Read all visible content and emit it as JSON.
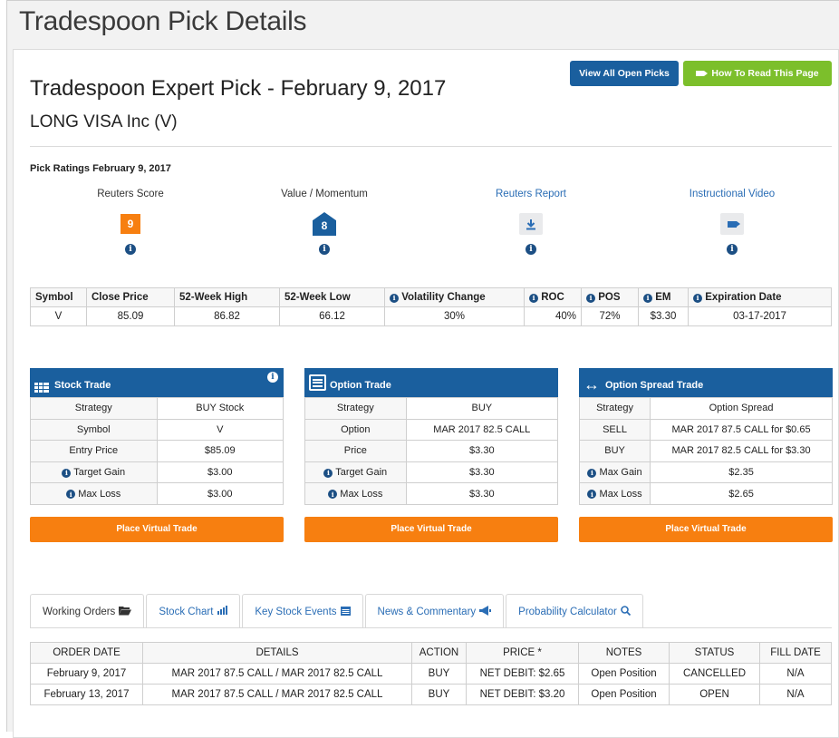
{
  "page_heading": "Tradespoon Pick Details",
  "buttons": {
    "view_all": "View All Open Picks",
    "how_to_read": "How To Read This Page"
  },
  "pick_title": "Tradespoon Expert Pick - February 9, 2017",
  "pick_subtitle": "LONG VISA Inc (V)",
  "ratings": {
    "title": "Pick Ratings February 9, 2017",
    "items": [
      {
        "label": "Reuters Score",
        "value": "9",
        "icon": "score-badge"
      },
      {
        "label": "Value / Momentum",
        "value": "8",
        "icon": "house-badge"
      },
      {
        "label": "Reuters Report",
        "value": "",
        "icon": "download-icon"
      },
      {
        "label": "Instructional Video",
        "value": "",
        "icon": "video-icon"
      }
    ]
  },
  "summary": {
    "headers": [
      "Symbol",
      "Close Price",
      "52-Week High",
      "52-Week Low",
      "Volatility Change",
      "ROC",
      "POS",
      "EM",
      "Expiration Date"
    ],
    "row": [
      "V",
      "85.09",
      "86.82",
      "66.12",
      "30%",
      "40%",
      "72%",
      "$3.30",
      "03-17-2017"
    ]
  },
  "cards": [
    {
      "title": "Stock Trade",
      "rows": [
        [
          "Strategy",
          "BUY Stock"
        ],
        [
          "Symbol",
          "V"
        ],
        [
          "Entry Price",
          "$85.09"
        ],
        [
          "Target Gain",
          "$3.00"
        ],
        [
          "Max Loss",
          "$3.00"
        ]
      ],
      "button": "Place Virtual Trade"
    },
    {
      "title": "Option Trade",
      "rows": [
        [
          "Strategy",
          "BUY"
        ],
        [
          "Option",
          "MAR 2017 82.5 CALL"
        ],
        [
          "Price",
          "$3.30"
        ],
        [
          "Target Gain",
          "$3.30"
        ],
        [
          "Max Loss",
          "$3.30"
        ]
      ],
      "button": "Place Virtual Trade"
    },
    {
      "title": "Option Spread Trade",
      "rows": [
        [
          "Strategy",
          "Option Spread"
        ],
        [
          "SELL",
          "MAR 2017 87.5 CALL for $0.65"
        ],
        [
          "BUY",
          "MAR 2017 82.5 CALL for $3.30"
        ],
        [
          "Max Gain",
          "$2.35"
        ],
        [
          "Max Loss",
          "$2.65"
        ]
      ],
      "button": "Place Virtual Trade"
    }
  ],
  "tabs": [
    "Working Orders",
    "Stock Chart",
    "Key Stock Events",
    "News & Commentary",
    "Probability Calculator"
  ],
  "orders": {
    "headers": [
      "ORDER DATE",
      "DETAILS",
      "ACTION",
      "PRICE *",
      "NOTES",
      "STATUS",
      "FILL DATE"
    ],
    "rows": [
      [
        "February 9, 2017",
        "MAR 2017 87.5 CALL / MAR 2017 82.5 CALL",
        "BUY",
        "NET DEBIT: $2.65",
        "Open Position",
        "CANCELLED",
        "N/A"
      ],
      [
        "February 13, 2017",
        "MAR 2017 87.5 CALL / MAR 2017 82.5 CALL",
        "BUY",
        "NET DEBIT: $3.20",
        "Open Position",
        "OPEN",
        "N/A"
      ]
    ]
  },
  "colors": {
    "brand_blue": "#1a5f9e",
    "orange": "#f77f10",
    "green": "#7cbf2b",
    "link": "#2a6db5"
  }
}
